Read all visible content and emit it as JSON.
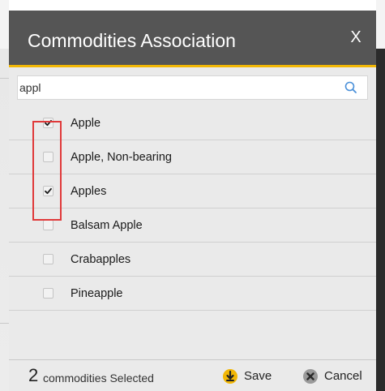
{
  "dialog": {
    "title": "Commodities Association",
    "close_label": "X"
  },
  "search": {
    "value": "appl",
    "placeholder": ""
  },
  "items": [
    {
      "label": "Apple",
      "checked": true
    },
    {
      "label": "Apple, Non-bearing",
      "checked": false
    },
    {
      "label": "Apples",
      "checked": true
    },
    {
      "label": "Balsam Apple",
      "checked": false
    },
    {
      "label": "Crabapples",
      "checked": false
    },
    {
      "label": "Pineapple",
      "checked": false
    }
  ],
  "footer": {
    "count": "2",
    "selected_text": "commodities Selected",
    "save_label": "Save",
    "cancel_label": "Cancel"
  },
  "colors": {
    "header_bg": "#555555",
    "accent": "#f2b705",
    "highlight": "#e0393a"
  },
  "icons": {
    "search": "search-icon",
    "close": "close-icon",
    "save": "save-icon",
    "cancel": "cancel-icon",
    "check": "checkmark-icon"
  }
}
